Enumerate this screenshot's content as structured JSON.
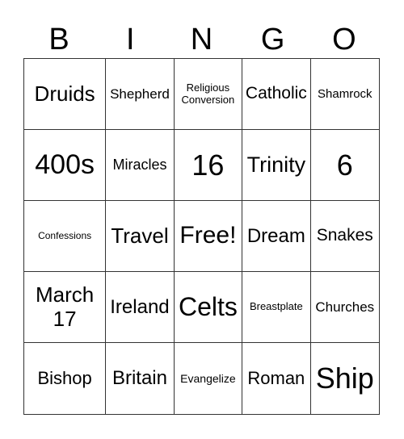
{
  "header": [
    "B",
    "I",
    "N",
    "G",
    "O"
  ],
  "cells": [
    "Druids",
    "Shepherd",
    "Religious Conversion",
    "Catholic",
    "Shamrock",
    "400s",
    "Miracles",
    "16",
    "Trinity",
    "6",
    "Confessions",
    "Travel",
    "Free!",
    "Dream",
    "Snakes",
    "March 17",
    "Ireland",
    "Celts",
    "Breastplate",
    "Churches",
    "Bishop",
    "Britain",
    "Evangelize",
    "Roman",
    "Ship"
  ]
}
